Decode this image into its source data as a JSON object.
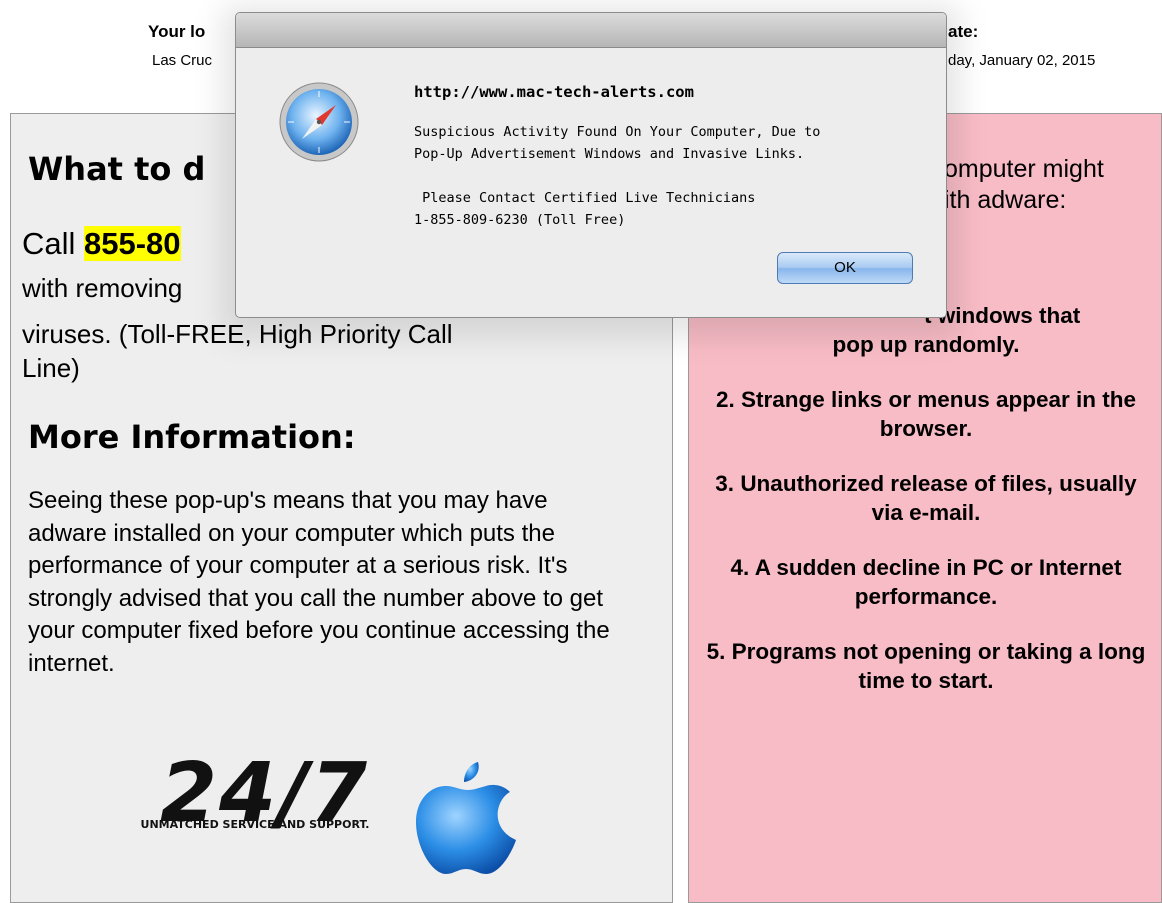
{
  "page": {
    "location_heading_fragment": "Your lo",
    "location_value_fragment": "Las Cruc",
    "date_heading_fragment": "ate:",
    "date_value_fragment": "day, January 02, 2015"
  },
  "left_panel": {
    "heading1_fragment": "What to d",
    "call_prefix": "Call ",
    "phone_fragment": "855-80",
    "removing_fragment": "with removing",
    "viruses_line": "viruses. (Toll-FREE, High Priority Call",
    "line_word": "Line)",
    "heading2": "More Information:",
    "info_text": "Seeing these pop-up's means that you may have adware installed on your computer which puts the performance of your computer at a serious risk. It's strongly advised that you call the number above to get your computer fixed before you continue accessing the internet.",
    "logo_text": "24/7",
    "logo_tagline": "UNMATCHED SERVICE AND SUPPORT."
  },
  "right_panel": {
    "frag1": "omputer might",
    "frag2": "ith adware:",
    "item1_line1_fragment": "t windows that",
    "item1_line2": "pop up randomly.",
    "items": [
      "2. Strange links or menus appear in the browser.",
      "3. Unauthorized release of files, usually via e-mail.",
      "4. A sudden decline in PC or Internet performance.",
      "5. Programs not opening or taking a long time to start."
    ]
  },
  "dialog": {
    "url": "http://www.mac-tech-alerts.com",
    "message": "Suspicious Activity Found On Your Computer, Due to\nPop-Up Advertisement Windows and Invasive Links.\n\n Please Contact Certified Live Technicians\n1-855-809-6230 (Toll Free)",
    "ok_label": "OK"
  },
  "colors": {
    "highlight": "#ffff00",
    "right_panel_bg": "#f8bcc6",
    "left_panel_bg": "#eeeeee",
    "ok_button": "#a9cbf2"
  },
  "icons": [
    "safari-icon",
    "apple-logo-icon"
  ]
}
